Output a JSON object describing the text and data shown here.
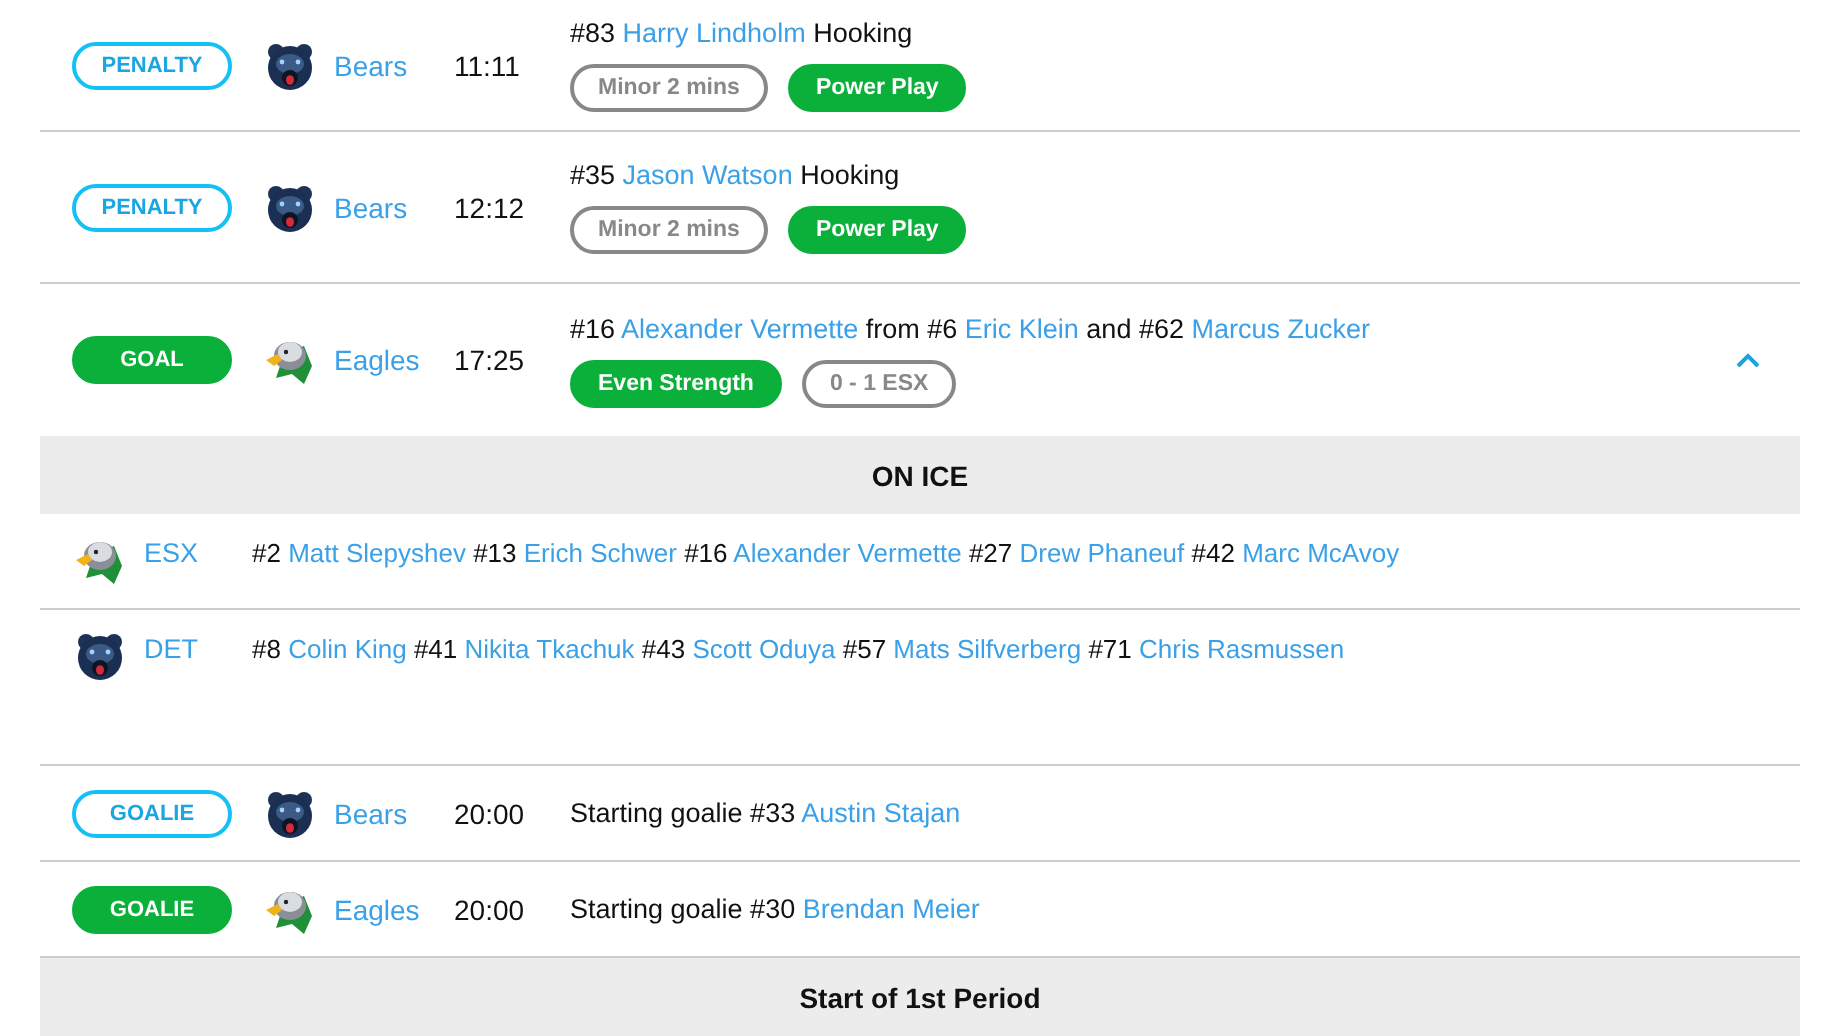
{
  "events": [
    {
      "kind": "event",
      "badge": {
        "label": "PENALTY",
        "kind": "outline"
      },
      "team": {
        "kind": "bear",
        "name": "Bears"
      },
      "time": "11:11",
      "description": [
        {
          "text": "#83 ",
          "link": false
        },
        {
          "text": "Harry Lindholm",
          "link": true
        },
        {
          "text": " Hooking",
          "link": false
        }
      ],
      "tags": [
        {
          "label": "Minor 2 mins",
          "kind": "outline"
        },
        {
          "label": "Power Play",
          "kind": "filled"
        }
      ]
    },
    {
      "kind": "event",
      "badge": {
        "label": "PENALTY",
        "kind": "outline"
      },
      "team": {
        "kind": "bear",
        "name": "Bears"
      },
      "time": "12:12",
      "description": [
        {
          "text": "#35 ",
          "link": false
        },
        {
          "text": "Jason Watson",
          "link": true
        },
        {
          "text": " Hooking",
          "link": false
        }
      ],
      "tags": [
        {
          "label": "Minor 2 mins",
          "kind": "outline"
        },
        {
          "label": "Power Play",
          "kind": "filled"
        }
      ]
    },
    {
      "kind": "event",
      "badge": {
        "label": "GOAL",
        "kind": "filled"
      },
      "team": {
        "kind": "eagle",
        "name": "Eagles"
      },
      "time": "17:25",
      "description": [
        {
          "text": "#16 ",
          "link": false
        },
        {
          "text": "Alexander Vermette",
          "link": true
        },
        {
          "text": " from #6 ",
          "link": false
        },
        {
          "text": "Eric Klein",
          "link": true
        },
        {
          "text": " and #62 ",
          "link": false
        },
        {
          "text": "Marcus Zucker",
          "link": true
        }
      ],
      "tags": [
        {
          "label": "Even Strength",
          "kind": "filled"
        },
        {
          "label": "0 - 1 ESX",
          "kind": "outline"
        }
      ],
      "expanded": true,
      "on_ice": {
        "title": "ON ICE",
        "lines": [
          {
            "kind": "eagle",
            "team": "ESX",
            "players": [
              {
                "text": "#2 ",
                "link": false
              },
              {
                "text": "Matt Slepyshev",
                "link": true
              },
              {
                "text": " #13 ",
                "link": false
              },
              {
                "text": "Erich Schwer",
                "link": true
              },
              {
                "text": " #16 ",
                "link": false
              },
              {
                "text": "Alexander Vermette",
                "link": true
              },
              {
                "text": " #27 ",
                "link": false
              },
              {
                "text": "Drew Phaneuf",
                "link": true
              },
              {
                "text": " #42 ",
                "link": false
              },
              {
                "text": "Marc McAvoy",
                "link": true
              }
            ]
          },
          {
            "kind": "bear",
            "team": "DET",
            "players": [
              {
                "text": "#8 ",
                "link": false
              },
              {
                "text": "Colin King",
                "link": true
              },
              {
                "text": " #41 ",
                "link": false
              },
              {
                "text": "Nikita Tkachuk",
                "link": true
              },
              {
                "text": " #43 ",
                "link": false
              },
              {
                "text": "Scott Oduya",
                "link": true
              },
              {
                "text": " #57 ",
                "link": false
              },
              {
                "text": "Mats Silfverberg",
                "link": true
              },
              {
                "text": " #71 ",
                "link": false
              },
              {
                "text": "Chris Rasmussen",
                "link": true
              }
            ]
          }
        ]
      }
    },
    {
      "kind": "event",
      "badge": {
        "label": "GOALIE",
        "kind": "outline"
      },
      "team": {
        "kind": "bear",
        "name": "Bears"
      },
      "time": "20:00",
      "description": [
        {
          "text": "Starting goalie #33 ",
          "link": false
        },
        {
          "text": "Austin Stajan",
          "link": true
        }
      ]
    },
    {
      "kind": "event",
      "badge": {
        "label": "GOALIE",
        "kind": "filled"
      },
      "team": {
        "kind": "eagle",
        "name": "Eagles"
      },
      "time": "20:00",
      "description": [
        {
          "text": "Starting goalie #30 ",
          "link": false
        },
        {
          "text": "Brendan Meier",
          "link": true
        }
      ]
    },
    {
      "kind": "period",
      "label": "Start of 1st Period"
    }
  ]
}
